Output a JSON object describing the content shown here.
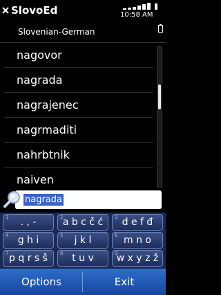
{
  "status_bar": {
    "app_title": "SlovoEd",
    "time": "10:58 AM"
  },
  "header": {
    "dictionary": "Slovenian-German"
  },
  "word_list": [
    {
      "label": "nagovor"
    },
    {
      "label": "nagrada"
    },
    {
      "label": "nagrajenec"
    },
    {
      "label": "nagrmaditi"
    },
    {
      "label": "nahrbtnik"
    },
    {
      "label": "naiven"
    }
  ],
  "search": {
    "value": "nagrada",
    "accent": "#3b63c8"
  },
  "keypad": {
    "keys": [
      {
        "num": "1",
        "chars": ". , -"
      },
      {
        "num": "2",
        "chars": "a b c č ć"
      },
      {
        "num": "3",
        "chars": "d e f đ"
      },
      {
        "num": "4",
        "chars": "g h i"
      },
      {
        "num": "5",
        "chars": "j k l"
      },
      {
        "num": "6",
        "chars": "m n o"
      },
      {
        "num": "7",
        "chars": "p q r s š"
      },
      {
        "num": "8",
        "chars": "t u v"
      },
      {
        "num": "9",
        "chars": "w x y z ž"
      }
    ]
  },
  "softkeys": {
    "left": "Options",
    "right": "Exit"
  }
}
